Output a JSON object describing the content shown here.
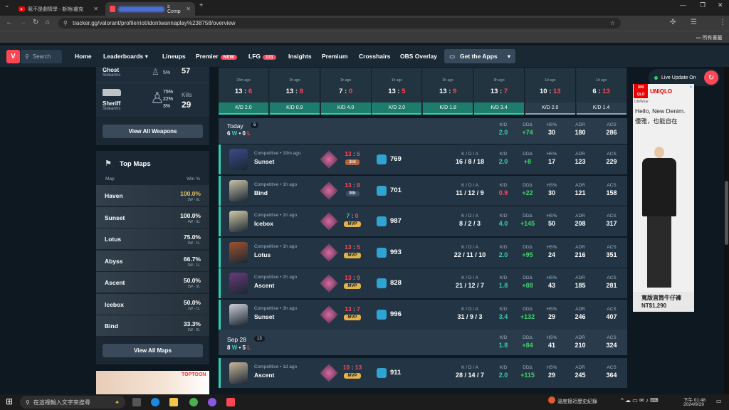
{
  "browser": {
    "tabs": [
      {
        "label": "我不是劇情學 - 新祂/盧克",
        "active": false
      },
      {
        "label": "s Comp",
        "active": true
      }
    ],
    "new_tab": "+",
    "url": "tracker.gg/valorant/profile/riot/idontwannaplay%238758/overview",
    "bookmarks_label": "所有書籤"
  },
  "site": {
    "search": "Search",
    "nav": [
      {
        "label": "Home"
      },
      {
        "label": "Leaderboards",
        "caret": true
      },
      {
        "label": "Lineups"
      },
      {
        "label": "Premier",
        "badge": "NEW"
      },
      {
        "label": "LFG",
        "badge": "121"
      },
      {
        "label": "Insights"
      },
      {
        "label": "Premium"
      },
      {
        "label": "Crosshairs"
      },
      {
        "label": "OBS Overlay"
      }
    ],
    "get_apps": "Get the Apps"
  },
  "weapons": {
    "ghost": {
      "name": "Ghost",
      "type": "Sidearms",
      "pct": "5%",
      "kills": "57"
    },
    "sheriff": {
      "name": "Sheriff",
      "type": "Sidearms",
      "head": "75%",
      "body": "22%",
      "legs": "3%",
      "kills_label": "Kills",
      "kills": "29"
    },
    "view_all": "View All Weapons"
  },
  "top_maps": {
    "title": "Top Maps",
    "col_map": "Map",
    "col_win": "Win %",
    "maps": [
      {
        "name": "Haven",
        "pct": "100.0%",
        "rec": "3W - 0L",
        "gold": true
      },
      {
        "name": "Sunset",
        "pct": "100.0%",
        "rec": "4W - 0L"
      },
      {
        "name": "Lotus",
        "pct": "75.0%",
        "rec": "3W - 1L"
      },
      {
        "name": "Abyss",
        "pct": "66.7%",
        "rec": "3W - 1L"
      },
      {
        "name": "Ascent",
        "pct": "50.0%",
        "rec": "3W - 3L"
      },
      {
        "name": "Icebox",
        "pct": "50.0%",
        "rec": "1W - 1L"
      },
      {
        "name": "Bind",
        "pct": "33.3%",
        "rec": "1W - 2L"
      }
    ],
    "view_all": "View All Maps"
  },
  "promo": "TOPTOON",
  "recent": [
    {
      "ago": "33m ago",
      "a": "13",
      "b": "6",
      "kd": "K/D 2.0",
      "win": true
    },
    {
      "ago": "1h ago",
      "a": "13",
      "b": "8",
      "kd": "K/D 0.9",
      "win": true
    },
    {
      "ago": "1h ago",
      "a": "7",
      "b": "0",
      "kd": "K/D 4.0",
      "win": true
    },
    {
      "ago": "1h ago",
      "a": "13",
      "b": "5",
      "kd": "K/D 2.0",
      "win": true
    },
    {
      "ago": "2h ago",
      "a": "13",
      "b": "9",
      "kd": "K/D 1.8",
      "win": true
    },
    {
      "ago": "3h ago",
      "a": "13",
      "b": "7",
      "kd": "K/D 3.4",
      "win": true
    },
    {
      "ago": "1d ago",
      "a": "10",
      "b": "13",
      "kd": "K/D 2.0",
      "win": false
    },
    {
      "ago": "1d ago",
      "a": "6",
      "b": "13",
      "kd": "K/D 1.4",
      "win": false
    }
  ],
  "headers": {
    "kda": "K / D / A",
    "kd": "K/D",
    "dda": "DDΔ",
    "hs": "HS%",
    "adr": "ADR",
    "acs": "ACS"
  },
  "today": {
    "label": "Today",
    "count": "6",
    "w": "6",
    "wl": "W",
    "l": "0",
    "ll": "L",
    "kd": "2.0",
    "dda": "+74",
    "hs": "30",
    "adr": "180",
    "acs": "286"
  },
  "sep28": {
    "label": "Sep 28",
    "count": "13",
    "w": "8",
    "wl": "W",
    "l": "5",
    "ll": "L",
    "kd": "1.8",
    "dda": "+84",
    "hs": "41",
    "adr": "210",
    "acs": "324"
  },
  "matches": [
    {
      "mode": "Competitive",
      "ago": "33m ago",
      "map": "Sunset",
      "a": "13",
      "b": "6",
      "place": "3rd",
      "rr": "769",
      "kda": "16 / 8 / 18",
      "kd": "2.0",
      "dda": "+8",
      "hs": "17",
      "adr": "123",
      "acs": "229",
      "agent_color": "#3d4a8a",
      "kd_red": false
    },
    {
      "mode": "Competitive",
      "ago": "1h ago",
      "map": "Bind",
      "a": "13",
      "b": "8",
      "place": "9th",
      "rr": "701",
      "kda": "11 / 12 / 9",
      "kd": "0.9",
      "dda": "+22",
      "hs": "30",
      "adr": "121",
      "acs": "158",
      "agent_color": "#c9c0a8",
      "kd_red": true
    },
    {
      "mode": "Competitive",
      "ago": "1h ago",
      "map": "Icebox",
      "a": "7",
      "b": "0",
      "place": "MVP",
      "rr": "987",
      "kda": "8 / 2 / 3",
      "kd": "4.0",
      "dda": "+145",
      "hs": "50",
      "adr": "208",
      "acs": "317",
      "agent_color": "#d3c9a4",
      "kd_red": false
    },
    {
      "mode": "Competitive",
      "ago": "1h ago",
      "map": "Lotus",
      "a": "13",
      "b": "5",
      "place": "MVP",
      "rr": "993",
      "kda": "22 / 11 / 10",
      "kd": "2.0",
      "dda": "+95",
      "hs": "24",
      "adr": "216",
      "acs": "351",
      "agent_color": "#a0522d",
      "kd_red": false
    },
    {
      "mode": "Competitive",
      "ago": "2h ago",
      "map": "Ascent",
      "a": "13",
      "b": "9",
      "place": "MVP",
      "rr": "828",
      "kda": "21 / 12 / 7",
      "kd": "1.8",
      "dda": "+88",
      "hs": "43",
      "adr": "185",
      "acs": "281",
      "agent_color": "#6a3a7a",
      "kd_red": false
    },
    {
      "mode": "Competitive",
      "ago": "3h ago",
      "map": "Sunset",
      "a": "13",
      "b": "7",
      "place": "MVP",
      "rr": "996",
      "kda": "31 / 9 / 3",
      "kd": "3.4",
      "dda": "+132",
      "hs": "29",
      "adr": "246",
      "acs": "407",
      "agent_color": "#cfcfd8",
      "kd_red": false
    }
  ],
  "match_sep": {
    "mode": "Competitive",
    "ago": "1d ago",
    "map": "Ascent",
    "a": "10",
    "b": "13",
    "place": "MVP",
    "rr": "911",
    "kda": "28 / 14 / 7",
    "kd": "2.0",
    "dda": "+115",
    "hs": "29",
    "adr": "245",
    "acs": "364",
    "agent_color": "#c9b89a"
  },
  "live": "Live Update On",
  "ad": {
    "brand": "UNIQLO",
    "sub": "LifeWear",
    "line1": "Hello, New Denim.",
    "line2": "優雅，也能自在",
    "caption": "寬版直筒牛仔褲",
    "price": "NT$1,290"
  },
  "taskbar": {
    "search": "在這裡輸入文字來搜尋",
    "weather": "溫度接近歷史紀錄",
    "time": "下午 01:48",
    "date": "2024/9/29"
  }
}
